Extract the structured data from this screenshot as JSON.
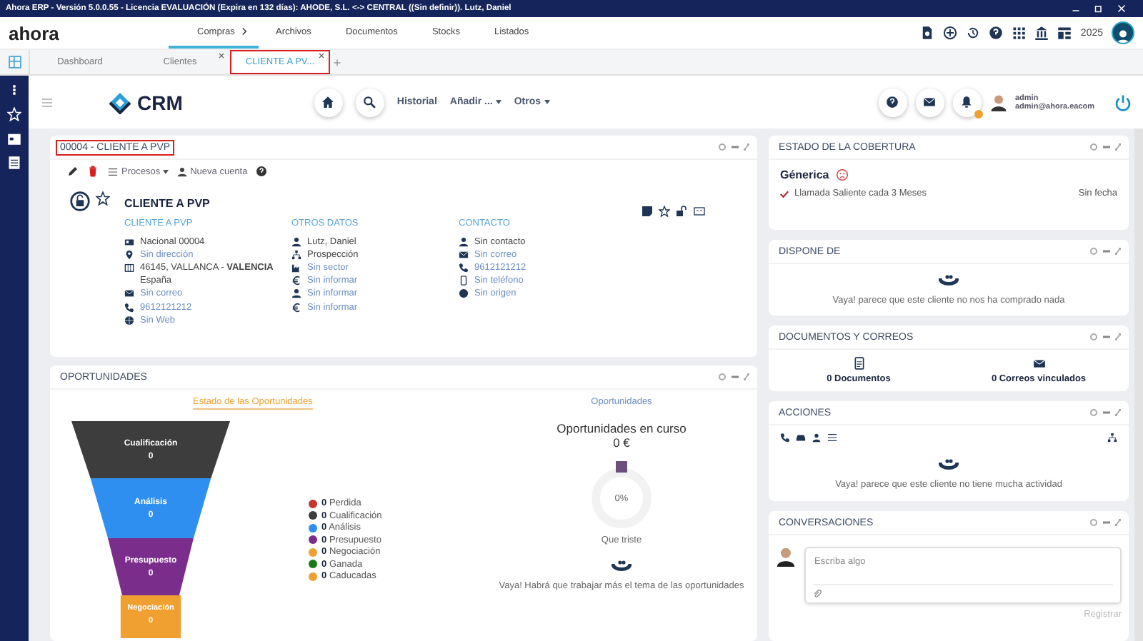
{
  "title_bar": {
    "title": "Ahora ERP - Versión 5.0.0.55 - Licencia EVALUACIÓN (Expira en 132 días): AHODE, S.L. <-> CENTRAL ((Sin definir)). Lutz, Daniel"
  },
  "app_header": {
    "logo": "ahora",
    "menu": [
      {
        "label": "Compras",
        "selected": true
      },
      {
        "label": "Archivos",
        "selected": false
      },
      {
        "label": "Documentos",
        "selected": false
      },
      {
        "label": "Stocks",
        "selected": false
      },
      {
        "label": "Listados",
        "selected": false
      }
    ],
    "year": "2025"
  },
  "tabs": [
    {
      "label": "Dashboard",
      "closable": false,
      "selected": false,
      "highlighted": false
    },
    {
      "label": "Clientes",
      "closable": true,
      "selected": false,
      "highlighted": false
    },
    {
      "label": "CLIENTE A PV...",
      "closable": true,
      "selected": true,
      "highlighted": true
    }
  ],
  "crm_bar": {
    "logo": "CRM",
    "links": [
      {
        "label": "Historial",
        "dropdown": false
      },
      {
        "label": "Añadir ...",
        "dropdown": true
      },
      {
        "label": "Otros",
        "dropdown": true
      }
    ],
    "user": {
      "name": "admin",
      "email": "admin@ahora.eacom"
    }
  },
  "client_card": {
    "title": "00004 - CLIENTE A PVP",
    "title_highlighted": true,
    "toolbar": {
      "processes": "Procesos",
      "new_account": "Nueva cuenta"
    },
    "name": "CLIENTE A PVP",
    "columns": [
      {
        "heading": "CLIENTE A PVP",
        "lines": [
          {
            "kind": "id",
            "text": "Nacional 00004",
            "link": false
          },
          {
            "kind": "pin",
            "text": "Sin dirección",
            "link": true
          },
          {
            "kind": "map",
            "text": "46145, VALLANCA - **VALENCIA**",
            "link": false
          },
          {
            "kind": "none",
            "text": "España",
            "link": false
          },
          {
            "kind": "mail",
            "text": "Sin correo",
            "link": true
          },
          {
            "kind": "phone",
            "text": "9612121212",
            "link": true
          },
          {
            "kind": "globe",
            "text": "Sin Web",
            "link": true
          }
        ]
      },
      {
        "heading": "OTROS DATOS",
        "lines": [
          {
            "kind": "user",
            "text": "Lutz, Daniel",
            "link": false
          },
          {
            "kind": "org",
            "text": "Prospección",
            "link": false
          },
          {
            "kind": "factory",
            "text": "Sin sector",
            "link": true
          },
          {
            "kind": "euro",
            "text": "Sin informar",
            "link": true
          },
          {
            "kind": "user",
            "text": "Sin informar",
            "link": true
          },
          {
            "kind": "euro",
            "text": "Sin informar",
            "link": true
          }
        ]
      },
      {
        "heading": "CONTACTO",
        "lines": [
          {
            "kind": "user",
            "text": "Sin contacto",
            "link": false
          },
          {
            "kind": "mail",
            "text": "Sin correo",
            "link": true
          },
          {
            "kind": "phone",
            "text": "9612121212",
            "link": true
          },
          {
            "kind": "mobile",
            "text": "Sin teléfono",
            "link": true
          },
          {
            "kind": "dot",
            "text": "Sin origen",
            "link": true
          }
        ]
      }
    ]
  },
  "opportunities": {
    "title": "OPORTUNIDADES",
    "left_title": "Estado de las Oportunidades",
    "right_title": "Oportunidades",
    "funnel": [
      {
        "name": "Cualificación",
        "count": "0",
        "color": "#3d3d3d"
      },
      {
        "name": "Análisis",
        "count": "0",
        "color": "#2f8ff0"
      },
      {
        "name": "Presupuesto",
        "count": "0",
        "color": "#7b2d8b"
      },
      {
        "name": "Negociación",
        "count": "0",
        "color": "#f0a030"
      }
    ],
    "legend": [
      {
        "count": "0",
        "name": "Perdida",
        "color": "#c0392b"
      },
      {
        "count": "0",
        "name": "Cualificación",
        "color": "#3d3d3d"
      },
      {
        "count": "0",
        "name": "Análisis",
        "color": "#2f8ff0"
      },
      {
        "count": "0",
        "name": "Presupuesto",
        "color": "#7b2d8b"
      },
      {
        "count": "0",
        "name": "Negociación",
        "color": "#f0a030"
      },
      {
        "count": "0",
        "name": "Ganada",
        "color": "#1a7a1a"
      },
      {
        "count": "0",
        "name": "Caducadas",
        "color": "#f0a030"
      }
    ],
    "in_progress": {
      "label": "Oportunidades en curso",
      "amount": "0 €",
      "percent": "0%",
      "caption": "Que triste"
    },
    "message": "Vaya! Habrá que trabajar más el tema de las oportunidades"
  },
  "coverage": {
    "title": "ESTADO DE LA COBERTURA",
    "type_name": "Génerica",
    "items": [
      {
        "text": "Llamada Saliente cada 3 Meses",
        "date": "Sin fecha",
        "done": true
      }
    ]
  },
  "purchases": {
    "title": "DISPONE DE",
    "message": "Vaya! parece que este cliente no nos ha comprado nada"
  },
  "documents": {
    "title": "DOCUMENTOS Y CORREOS",
    "items": [
      {
        "kind": "documents",
        "label": "0 Documentos"
      },
      {
        "kind": "emails",
        "label": "0 Correos vinculados"
      }
    ]
  },
  "actions": {
    "title": "ACCIONES",
    "message": "Vaya! parece que este cliente no tiene mucha actividad"
  },
  "conversations": {
    "title": "CONVERSACIONES",
    "placeholder": "Escriba algo",
    "button": "Registrar"
  }
}
